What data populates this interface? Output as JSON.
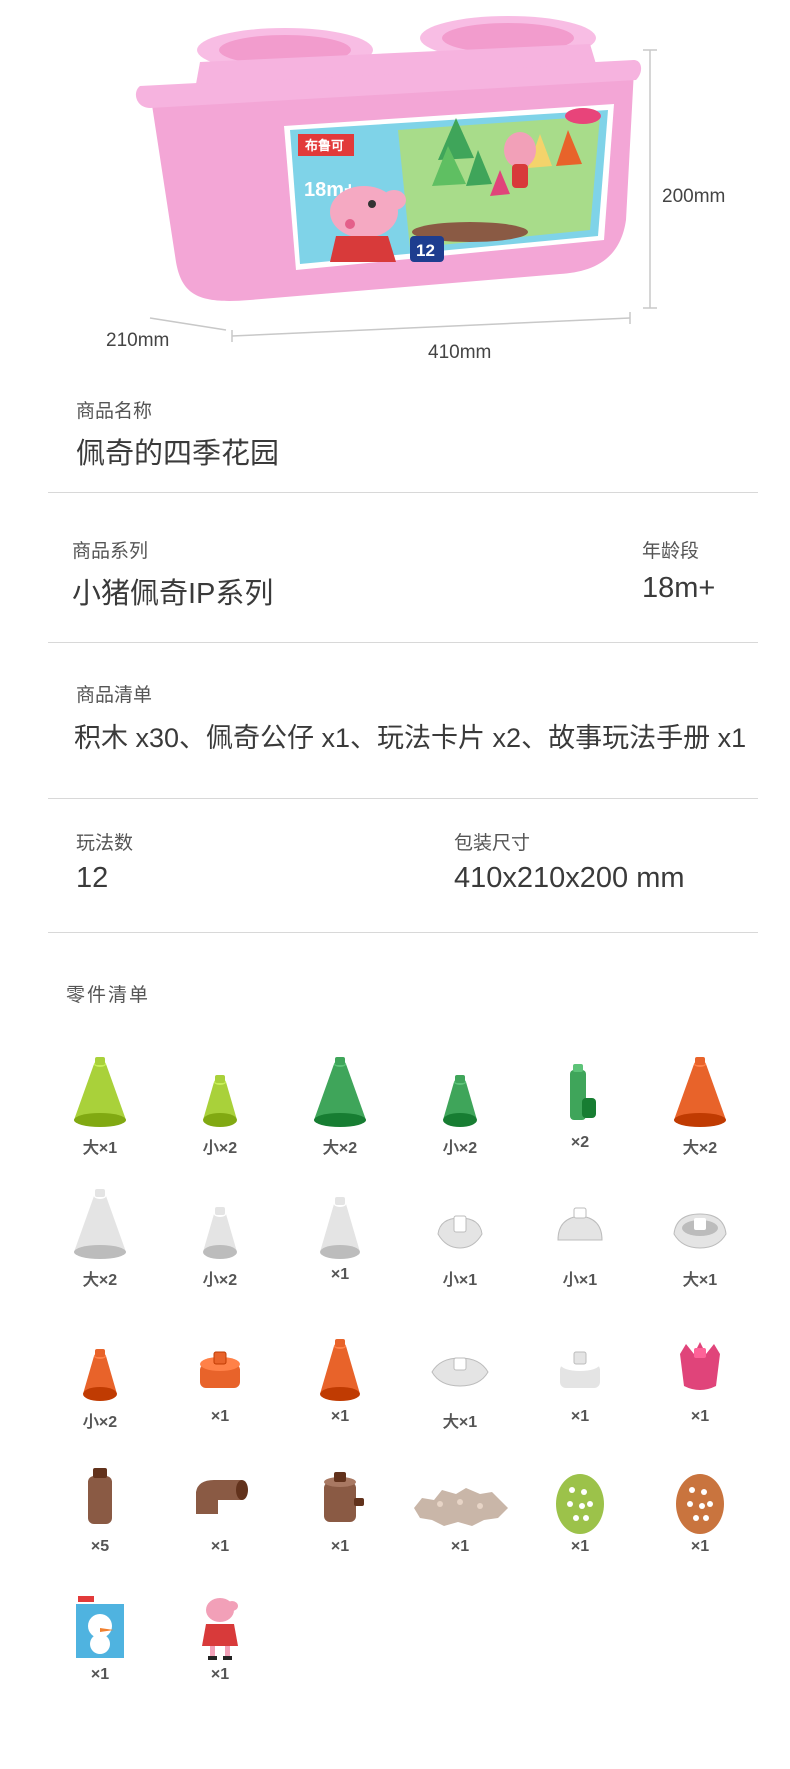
{
  "dimensions": {
    "height": "200mm",
    "depth": "210mm",
    "width": "410mm"
  },
  "box_graphic": {
    "brand_logo": "布鲁可",
    "age_badge": "18m+",
    "count_badge": "12",
    "colors": {
      "box": "#f3a6d6",
      "lid": "#f6b3df",
      "label_bg": "#7fd3e8"
    }
  },
  "product": {
    "name_label": "商品名称",
    "name": "佩奇的四季花园",
    "series_label": "商品系列",
    "series": "小猪佩奇IP系列",
    "age_label": "年龄段",
    "age": "18m+",
    "contents_label": "商品清单",
    "contents": "积木 x30、佩奇公仔 x1、玩法卡片 x2、故事玩法手册 x1",
    "play_count_label": "玩法数",
    "play_count": "12",
    "package_size_label": "包装尺寸",
    "package_size": "410x210x200 mm"
  },
  "parts_list": {
    "title": "零件清单",
    "items": [
      {
        "icon": "lime-cone-large-icon",
        "qty": "大×1",
        "color": "#a9d13a"
      },
      {
        "icon": "lime-cone-small-icon",
        "qty": "小×2",
        "color": "#a9d13a"
      },
      {
        "icon": "green-cone-large-icon",
        "qty": "大×2",
        "color": "#3fa55a"
      },
      {
        "icon": "green-cone-small-icon",
        "qty": "小×2",
        "color": "#3fa55a"
      },
      {
        "icon": "green-stem-icon",
        "qty": "×2",
        "color": "#3fa55a"
      },
      {
        "icon": "orange-cone-large-icon",
        "qty": "大×2",
        "color": "#e8632a"
      },
      {
        "icon": "white-cone-large-icon",
        "qty": "大×2",
        "color": "#e4e4e4"
      },
      {
        "icon": "white-cone-small-icon",
        "qty": "小×2",
        "color": "#e4e4e4"
      },
      {
        "icon": "white-cone-icon",
        "qty": "×1",
        "color": "#e4e4e4"
      },
      {
        "icon": "white-flower-small-icon",
        "qty": "小×1",
        "color": "#e4e4e4"
      },
      {
        "icon": "white-dome-small-icon",
        "qty": "小×1",
        "color": "#e4e4e4"
      },
      {
        "icon": "white-flower-large-icon",
        "qty": "大×1",
        "color": "#e4e4e4"
      },
      {
        "icon": "orange-cone-small-icon",
        "qty": "小×2",
        "color": "#e8632a"
      },
      {
        "icon": "orange-round-block-icon",
        "qty": "×1",
        "color": "#e8632a"
      },
      {
        "icon": "orange-cone-icon",
        "qty": "×1",
        "color": "#e8632a"
      },
      {
        "icon": "white-flower-plate-large-icon",
        "qty": "大×1",
        "color": "#e4e4e4"
      },
      {
        "icon": "white-round-block-icon",
        "qty": "×1",
        "color": "#e4e4e4"
      },
      {
        "icon": "pink-tulip-icon",
        "qty": "×1",
        "color": "#e0447a"
      },
      {
        "icon": "brown-log-icon",
        "qty": "×5",
        "color": "#8a5a44"
      },
      {
        "icon": "brown-elbow-icon",
        "qty": "×1",
        "color": "#8a5a44"
      },
      {
        "icon": "brown-stump-icon",
        "qty": "×1",
        "color": "#8a5a44"
      },
      {
        "icon": "gear-base-plate-icon",
        "qty": "×1",
        "color": "#c9b6a8"
      },
      {
        "icon": "green-round-plate-icon",
        "qty": "×1",
        "color": "#9cc24a"
      },
      {
        "icon": "orange-round-plate-icon",
        "qty": "×1",
        "color": "#c9743e"
      },
      {
        "icon": "play-card-icon",
        "qty": "×1",
        "color": "#4fb3e0"
      },
      {
        "icon": "peppa-figure-icon",
        "qty": "×1",
        "color": "#f2a0b8"
      }
    ]
  }
}
